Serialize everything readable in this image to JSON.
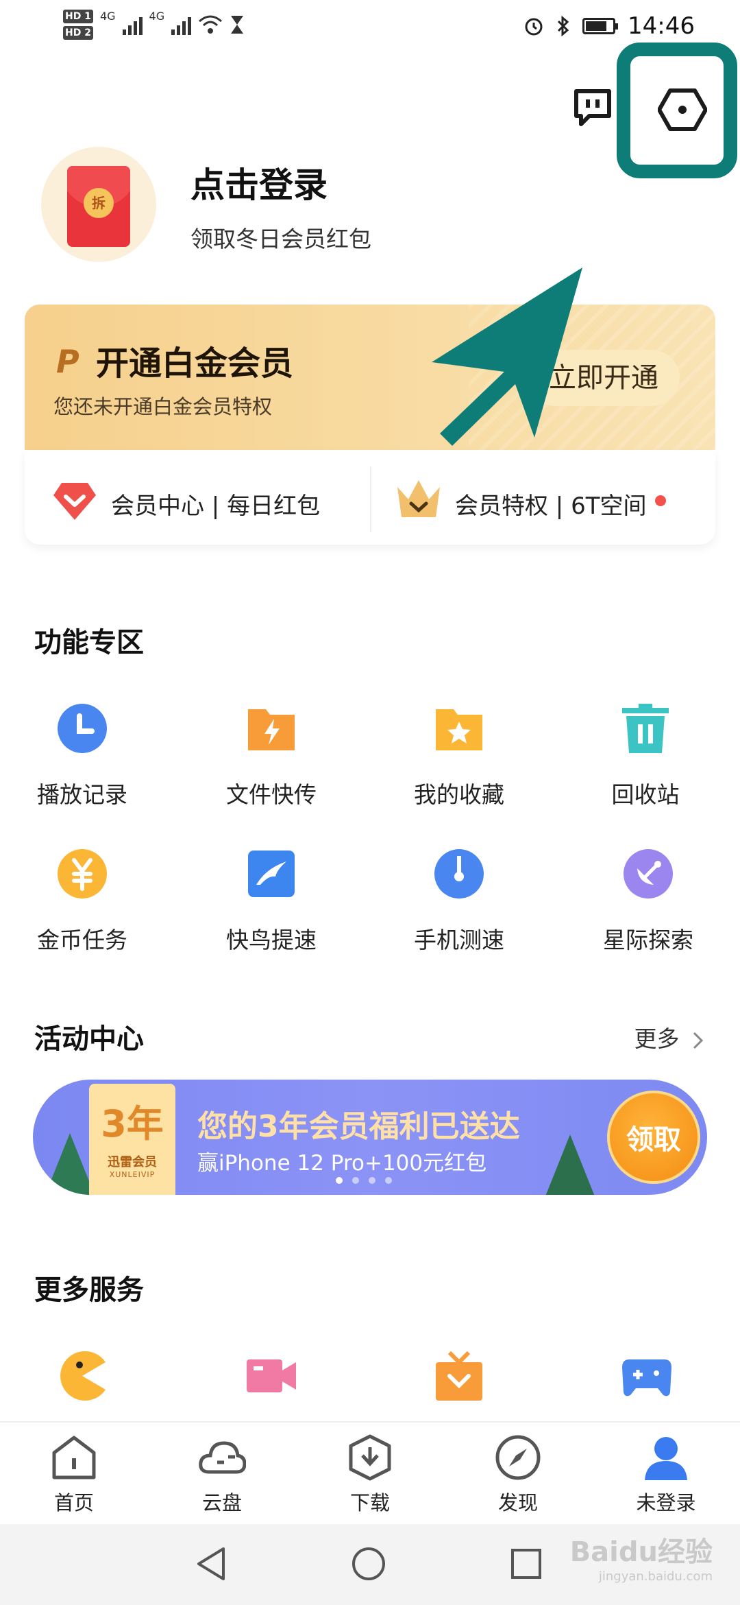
{
  "status_bar": {
    "time": "14:46",
    "sim1": "HD 1",
    "sim2": "HD 2",
    "net1": "4G",
    "net2": "4G"
  },
  "profile": {
    "title": "点击登录",
    "subtitle": "领取冬日会员红包",
    "badge_char": "拆"
  },
  "vip": {
    "title": "开通白金会员",
    "subtitle": "您还未开通白金会员特权",
    "button": "立即开通",
    "logo": "P"
  },
  "vip_links": [
    {
      "label": "会员中心 | 每日红包",
      "icon": "diamond-heart-icon"
    },
    {
      "label": "会员特权 | 6T空间",
      "icon": "crown-icon"
    }
  ],
  "features": {
    "title": "功能专区",
    "items": [
      {
        "label": "播放记录",
        "icon": "clock-icon",
        "color": "#4a86f0"
      },
      {
        "label": "文件快传",
        "icon": "bolt-folder-icon",
        "color": "#f79c38"
      },
      {
        "label": "我的收藏",
        "icon": "star-folder-icon",
        "color": "#fbb635"
      },
      {
        "label": "回收站",
        "icon": "trash-icon",
        "color": "#3cc4c4"
      },
      {
        "label": "金币任务",
        "icon": "coin-icon",
        "color": "#fbb635"
      },
      {
        "label": "快鸟提速",
        "icon": "bird-icon",
        "color": "#3d86f0"
      },
      {
        "label": "手机测速",
        "icon": "speed-icon",
        "color": "#4a86f0"
      },
      {
        "label": "星际探索",
        "icon": "satellite-icon",
        "color": "#9b86f0"
      }
    ]
  },
  "activity": {
    "title": "活动中心",
    "more": "更多",
    "banner": {
      "badge_year": "3年",
      "badge_brand": "迅雷会员",
      "badge_sub": "XUNLEIVIP",
      "title": "您的3年会员福利已送达",
      "subtitle": "赢iPhone 12 Pro+100元红包",
      "button": "领取"
    }
  },
  "services": {
    "title": "更多服务",
    "items": [
      {
        "icon": "pacman-icon",
        "color": "#fbb635"
      },
      {
        "icon": "video-camera-icon",
        "color": "#f07aa4"
      },
      {
        "icon": "gift-box-icon",
        "color": "#f79c38"
      },
      {
        "icon": "gamepad-icon",
        "color": "#4a86f0"
      }
    ]
  },
  "bottom_nav": [
    {
      "label": "首页",
      "icon": "home-icon"
    },
    {
      "label": "云盘",
      "icon": "cloud-icon"
    },
    {
      "label": "下载",
      "icon": "download-icon"
    },
    {
      "label": "发现",
      "icon": "compass-icon"
    },
    {
      "label": "未登录",
      "icon": "user-icon"
    }
  ],
  "watermark": {
    "text": "Baidu经验",
    "sub": "jingyan.baidu.com"
  },
  "colors": {
    "highlight": "#0e7c77",
    "accent_blue": "#3a7cf0",
    "vip_gold": "#f6d08c"
  }
}
